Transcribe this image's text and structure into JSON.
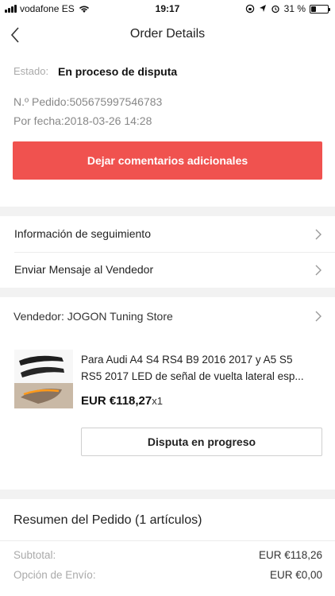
{
  "status_bar": {
    "carrier": "vodafone ES",
    "time": "19:17",
    "battery_percent": "31 %",
    "battery_level": 0.31
  },
  "nav": {
    "title": "Order Details",
    "back_icon": "chevron-left-icon"
  },
  "order": {
    "status_label": "Estado:",
    "status_value": "En proceso de disputa",
    "order_number": "N.º Pedido:505675997546783",
    "order_date": "Por fecha:2018-03-26 14:28",
    "feedback_button": "Dejar comentarios adicionales"
  },
  "actions": {
    "tracking": "Información de seguimiento",
    "message_seller": "Enviar Mensaje al Vendedor"
  },
  "seller": {
    "label": "Vendedor: JOGON Tuning Store"
  },
  "product": {
    "title_line1": "Para Audi A4 S4 RS4 B9 2016 2017 y A5 S5",
    "title_line2": "RS5 2017 LED de señal de vuelta lateral esp...",
    "price": "EUR €118,27",
    "quantity": "x1",
    "dispute_button": "Disputa en progreso"
  },
  "summary": {
    "title": "Resumen del Pedido (1 artículos)",
    "subtotal_label": "Subtotal:",
    "subtotal_value": "EUR €118,26",
    "shipping_label": "Opción de Envío:",
    "shipping_value": "EUR €0,00"
  },
  "colors": {
    "accent": "#f0524f",
    "separator": "#f2f2f2"
  }
}
